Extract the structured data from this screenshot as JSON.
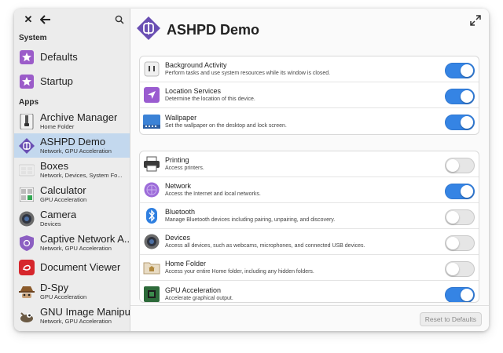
{
  "window": {
    "title": "ASHPD Demo"
  },
  "sidebar": {
    "sections": {
      "system": "System",
      "apps": "Apps"
    },
    "system_items": [
      {
        "label": "Defaults",
        "icon": "star-icon"
      },
      {
        "label": "Startup",
        "icon": "star-icon"
      }
    ],
    "app_items": [
      {
        "label": "Archive Manager",
        "sub": "Home Folder",
        "icon": "archive-icon"
      },
      {
        "label": "ASHPD Demo",
        "sub": "Network, GPU Acceleration",
        "icon": "ashpd-icon",
        "selected": true
      },
      {
        "label": "Boxes",
        "sub": "Network, Devices, System Fo...",
        "icon": "boxes-icon"
      },
      {
        "label": "Calculator",
        "sub": "GPU Acceleration",
        "icon": "calculator-icon"
      },
      {
        "label": "Camera",
        "sub": "Devices",
        "icon": "camera-icon"
      },
      {
        "label": "Captive Network A...",
        "sub": "Network, GPU Acceleration",
        "icon": "shield-icon"
      },
      {
        "label": "Document Viewer",
        "sub": "",
        "icon": "document-viewer-icon"
      },
      {
        "label": "D-Spy",
        "sub": "GPU Acceleration",
        "icon": "spy-icon"
      },
      {
        "label": "GNU Image Manipu...",
        "sub": "Network, GPU Acceleration",
        "icon": "gimp-icon"
      }
    ]
  },
  "main": {
    "app_title": "ASHPD Demo",
    "reset_label": "Reset to Defaults",
    "group1": [
      {
        "title": "Background Activity",
        "sub": "Perform tasks and use system resources while its window is closed.",
        "on": true,
        "icon": "background-icon"
      },
      {
        "title": "Location Services",
        "sub": "Determine the location of this device.",
        "on": true,
        "icon": "location-icon"
      },
      {
        "title": "Wallpaper",
        "sub": "Set the wallpaper on the desktop and lock screen.",
        "on": true,
        "icon": "wallpaper-icon"
      }
    ],
    "group2": [
      {
        "title": "Printing",
        "sub": "Access printers.",
        "on": false,
        "icon": "printer-icon"
      },
      {
        "title": "Network",
        "sub": "Access the Internet and local networks.",
        "on": true,
        "icon": "network-icon"
      },
      {
        "title": "Bluetooth",
        "sub": "Manage Bluetooth devices including pairing, unpairing, and discovery.",
        "on": false,
        "icon": "bluetooth-icon"
      },
      {
        "title": "Devices",
        "sub": "Access all devices, such as webcams, microphones, and connected USB devices.",
        "on": false,
        "icon": "devices-icon"
      },
      {
        "title": "Home Folder",
        "sub": "Access your entire Home folder, including any hidden folders.",
        "on": false,
        "icon": "home-folder-icon"
      },
      {
        "title": "GPU Acceleration",
        "sub": "Accelerate graphical output.",
        "on": true,
        "icon": "gpu-icon"
      }
    ]
  }
}
